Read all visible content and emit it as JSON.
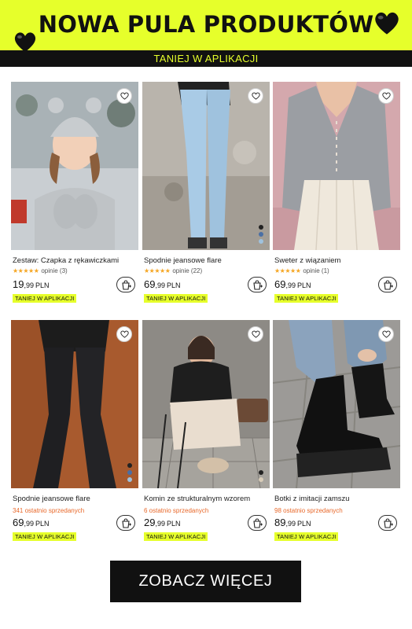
{
  "banner": {
    "title": "NOWA PULA PRODUKTÓW",
    "subtitle": "TANIEJ W APLIKACJI"
  },
  "products": [
    {
      "name": "Zestaw: Czapka z rękawiczkami",
      "rating_text": "opinie (3)",
      "stars": "★★★★★",
      "price_int": "19",
      "price_dec": ",99",
      "currency": "PLN",
      "badge": "TANIEJ W APLIKACJI"
    },
    {
      "name": "Spodnie jeansowe flare",
      "rating_text": "opinie (22)",
      "stars": "★★★★★",
      "price_int": "69",
      "price_dec": ",99",
      "currency": "PLN",
      "badge": "TANIEJ W APLIKACJI"
    },
    {
      "name": "Sweter z wiązaniem",
      "rating_text": "opinie (1)",
      "stars": "★★★★★",
      "price_int": "69",
      "price_dec": ",99",
      "currency": "PLN",
      "badge": "TANIEJ W APLIKACJI"
    },
    {
      "name": "Spodnie jeansowe flare",
      "sold_text": "341 ostatnio sprzedanych",
      "price_int": "69",
      "price_dec": ",99",
      "currency": "PLN",
      "badge": "TANIEJ W APLIKACJI"
    },
    {
      "name": "Komin ze strukturalnym wzorem",
      "sold_text": "6 ostatnio sprzedanych",
      "price_int": "29",
      "price_dec": ",99",
      "currency": "PLN",
      "badge": "TANIEJ W APLIKACJI"
    },
    {
      "name": "Botki z imitacji zamszu",
      "sold_text": "98 ostatnio sprzedanych",
      "price_int": "89",
      "price_dec": ",99",
      "currency": "PLN",
      "badge": "TANIEJ W APLIKACJI"
    }
  ],
  "cta": {
    "label": "ZOBACZ WIĘCEJ"
  },
  "colors": {
    "accent": "#e6ff2b",
    "dark": "#111111",
    "star": "#f5a623",
    "sold": "#e8682a"
  }
}
